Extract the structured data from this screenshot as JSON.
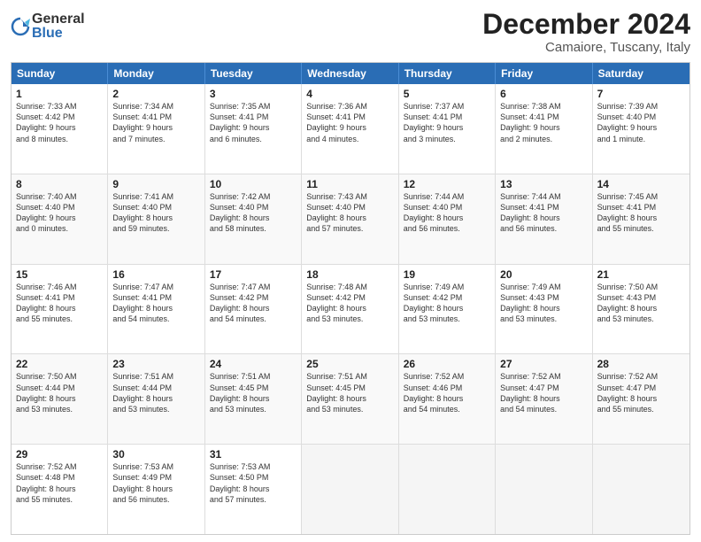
{
  "header": {
    "logo": {
      "general": "General",
      "blue": "Blue"
    },
    "title": "December 2024",
    "location": "Camaiore, Tuscany, Italy"
  },
  "days_of_week": [
    "Sunday",
    "Monday",
    "Tuesday",
    "Wednesday",
    "Thursday",
    "Friday",
    "Saturday"
  ],
  "weeks": [
    [
      {
        "day": 1,
        "info": "Sunrise: 7:33 AM\nSunset: 4:42 PM\nDaylight: 9 hours\nand 8 minutes."
      },
      {
        "day": 2,
        "info": "Sunrise: 7:34 AM\nSunset: 4:41 PM\nDaylight: 9 hours\nand 7 minutes."
      },
      {
        "day": 3,
        "info": "Sunrise: 7:35 AM\nSunset: 4:41 PM\nDaylight: 9 hours\nand 6 minutes."
      },
      {
        "day": 4,
        "info": "Sunrise: 7:36 AM\nSunset: 4:41 PM\nDaylight: 9 hours\nand 4 minutes."
      },
      {
        "day": 5,
        "info": "Sunrise: 7:37 AM\nSunset: 4:41 PM\nDaylight: 9 hours\nand 3 minutes."
      },
      {
        "day": 6,
        "info": "Sunrise: 7:38 AM\nSunset: 4:41 PM\nDaylight: 9 hours\nand 2 minutes."
      },
      {
        "day": 7,
        "info": "Sunrise: 7:39 AM\nSunset: 4:40 PM\nDaylight: 9 hours\nand 1 minute."
      }
    ],
    [
      {
        "day": 8,
        "info": "Sunrise: 7:40 AM\nSunset: 4:40 PM\nDaylight: 9 hours\nand 0 minutes."
      },
      {
        "day": 9,
        "info": "Sunrise: 7:41 AM\nSunset: 4:40 PM\nDaylight: 8 hours\nand 59 minutes."
      },
      {
        "day": 10,
        "info": "Sunrise: 7:42 AM\nSunset: 4:40 PM\nDaylight: 8 hours\nand 58 minutes."
      },
      {
        "day": 11,
        "info": "Sunrise: 7:43 AM\nSunset: 4:40 PM\nDaylight: 8 hours\nand 57 minutes."
      },
      {
        "day": 12,
        "info": "Sunrise: 7:44 AM\nSunset: 4:40 PM\nDaylight: 8 hours\nand 56 minutes."
      },
      {
        "day": 13,
        "info": "Sunrise: 7:44 AM\nSunset: 4:41 PM\nDaylight: 8 hours\nand 56 minutes."
      },
      {
        "day": 14,
        "info": "Sunrise: 7:45 AM\nSunset: 4:41 PM\nDaylight: 8 hours\nand 55 minutes."
      }
    ],
    [
      {
        "day": 15,
        "info": "Sunrise: 7:46 AM\nSunset: 4:41 PM\nDaylight: 8 hours\nand 55 minutes."
      },
      {
        "day": 16,
        "info": "Sunrise: 7:47 AM\nSunset: 4:41 PM\nDaylight: 8 hours\nand 54 minutes."
      },
      {
        "day": 17,
        "info": "Sunrise: 7:47 AM\nSunset: 4:42 PM\nDaylight: 8 hours\nand 54 minutes."
      },
      {
        "day": 18,
        "info": "Sunrise: 7:48 AM\nSunset: 4:42 PM\nDaylight: 8 hours\nand 53 minutes."
      },
      {
        "day": 19,
        "info": "Sunrise: 7:49 AM\nSunset: 4:42 PM\nDaylight: 8 hours\nand 53 minutes."
      },
      {
        "day": 20,
        "info": "Sunrise: 7:49 AM\nSunset: 4:43 PM\nDaylight: 8 hours\nand 53 minutes."
      },
      {
        "day": 21,
        "info": "Sunrise: 7:50 AM\nSunset: 4:43 PM\nDaylight: 8 hours\nand 53 minutes."
      }
    ],
    [
      {
        "day": 22,
        "info": "Sunrise: 7:50 AM\nSunset: 4:44 PM\nDaylight: 8 hours\nand 53 minutes."
      },
      {
        "day": 23,
        "info": "Sunrise: 7:51 AM\nSunset: 4:44 PM\nDaylight: 8 hours\nand 53 minutes."
      },
      {
        "day": 24,
        "info": "Sunrise: 7:51 AM\nSunset: 4:45 PM\nDaylight: 8 hours\nand 53 minutes."
      },
      {
        "day": 25,
        "info": "Sunrise: 7:51 AM\nSunset: 4:45 PM\nDaylight: 8 hours\nand 53 minutes."
      },
      {
        "day": 26,
        "info": "Sunrise: 7:52 AM\nSunset: 4:46 PM\nDaylight: 8 hours\nand 54 minutes."
      },
      {
        "day": 27,
        "info": "Sunrise: 7:52 AM\nSunset: 4:47 PM\nDaylight: 8 hours\nand 54 minutes."
      },
      {
        "day": 28,
        "info": "Sunrise: 7:52 AM\nSunset: 4:47 PM\nDaylight: 8 hours\nand 55 minutes."
      }
    ],
    [
      {
        "day": 29,
        "info": "Sunrise: 7:52 AM\nSunset: 4:48 PM\nDaylight: 8 hours\nand 55 minutes."
      },
      {
        "day": 30,
        "info": "Sunrise: 7:53 AM\nSunset: 4:49 PM\nDaylight: 8 hours\nand 56 minutes."
      },
      {
        "day": 31,
        "info": "Sunrise: 7:53 AM\nSunset: 4:50 PM\nDaylight: 8 hours\nand 57 minutes."
      },
      {
        "day": null,
        "info": ""
      },
      {
        "day": null,
        "info": ""
      },
      {
        "day": null,
        "info": ""
      },
      {
        "day": null,
        "info": ""
      }
    ]
  ]
}
